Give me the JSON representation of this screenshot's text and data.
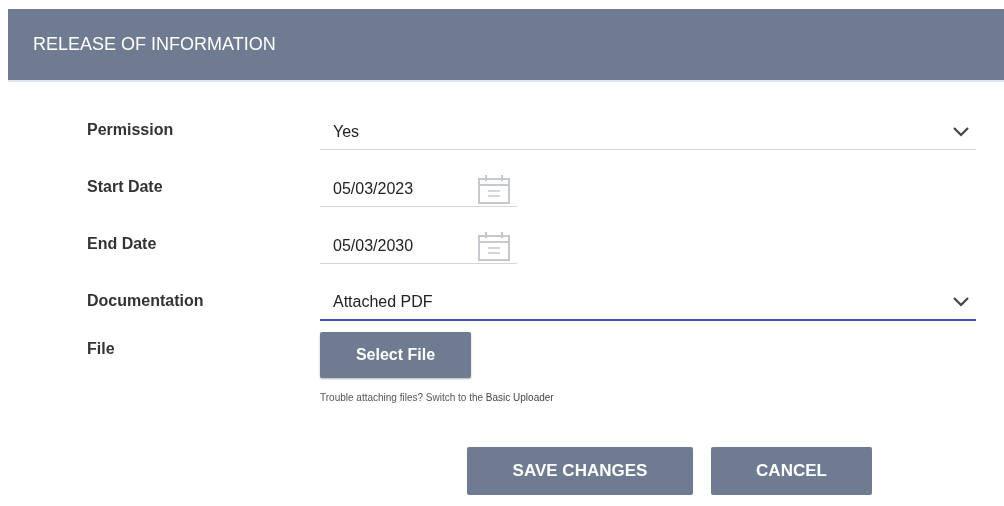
{
  "header": {
    "title": "RELEASE OF INFORMATION"
  },
  "fields": [
    {
      "kind": "select",
      "label": "Permission",
      "value": "Yes",
      "focused": false
    },
    {
      "kind": "date",
      "label": "Start Date",
      "value": "05/03/2023",
      "focused": false
    },
    {
      "kind": "date",
      "label": "End Date",
      "value": "05/03/2030",
      "focused": false
    },
    {
      "kind": "select",
      "label": "Documentation",
      "value": "Attached PDF",
      "focused": true
    }
  ],
  "file": {
    "label": "File",
    "button": "Select File",
    "help": "Trouble attaching files? Switch to the",
    "link": "Basic Uploader"
  },
  "buttons": [
    "SAVE CHANGES",
    "CANCEL"
  ]
}
